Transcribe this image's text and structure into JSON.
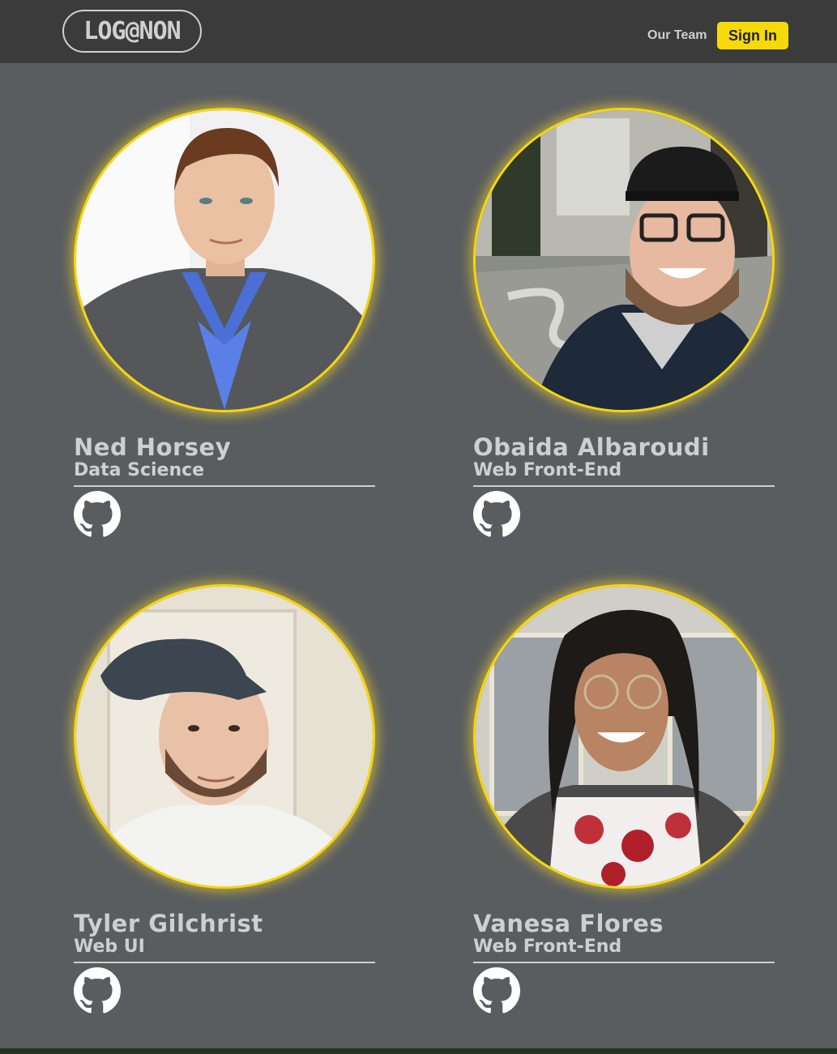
{
  "navbar": {
    "logo_text": "LOG@NON",
    "links": [
      {
        "label": "Our Team"
      }
    ],
    "signin_label": "Sign In"
  },
  "colors": {
    "background": "#5a5d60",
    "navbar": "#3b3b3b",
    "accent": "#f7d80a",
    "text": "#cfcfcf"
  },
  "team": [
    {
      "name": "Ned Horsey",
      "role": "Data Science",
      "icon": "github-icon"
    },
    {
      "name": "Obaida Albaroudi",
      "role": "Web Front-End",
      "icon": "github-icon"
    },
    {
      "name": "Tyler Gilchrist",
      "role": "Web UI",
      "icon": "github-icon"
    },
    {
      "name": "Vanesa Flores",
      "role": "Web Front-End",
      "icon": "github-icon"
    }
  ]
}
